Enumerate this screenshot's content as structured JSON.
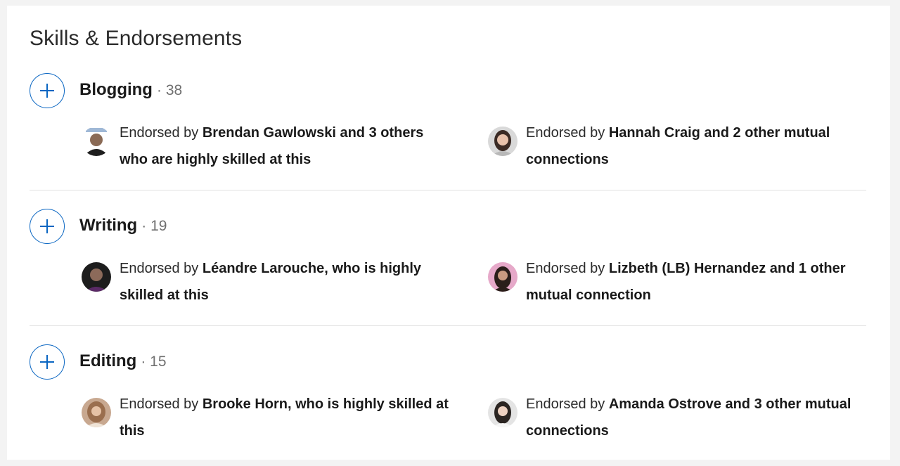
{
  "section": {
    "title": "Skills & Endorsements"
  },
  "skills": [
    {
      "name": "Blogging",
      "count": "38",
      "endorsements": [
        {
          "prefix": "Endorsed by ",
          "highlight": "Brendan Gawlowski and 3 others who are highly skilled at this",
          "avatar": "avatar-brendan"
        },
        {
          "prefix": "Endorsed by ",
          "highlight": "Hannah Craig and 2 other mutual connections",
          "avatar": "avatar-hannah"
        }
      ]
    },
    {
      "name": "Writing",
      "count": "19",
      "endorsements": [
        {
          "prefix": "Endorsed by ",
          "highlight": "Léandre Larouche, who is highly skilled at this",
          "avatar": "avatar-leandre"
        },
        {
          "prefix": "Endorsed by ",
          "highlight": "Lizbeth (LB) Hernandez and 1 other mutual connection",
          "avatar": "avatar-lizbeth"
        }
      ]
    },
    {
      "name": "Editing",
      "count": "15",
      "endorsements": [
        {
          "prefix": "Endorsed by ",
          "highlight": "Brooke Horn, who is highly skilled at this",
          "avatar": "avatar-brooke"
        },
        {
          "prefix": "Endorsed by ",
          "highlight": "Amanda Ostrove and 3 other mutual connections",
          "avatar": "avatar-amanda"
        }
      ]
    }
  ],
  "separator": "·",
  "colors": {
    "accent": "#0a66c2",
    "divider": "#e0e0e0"
  }
}
